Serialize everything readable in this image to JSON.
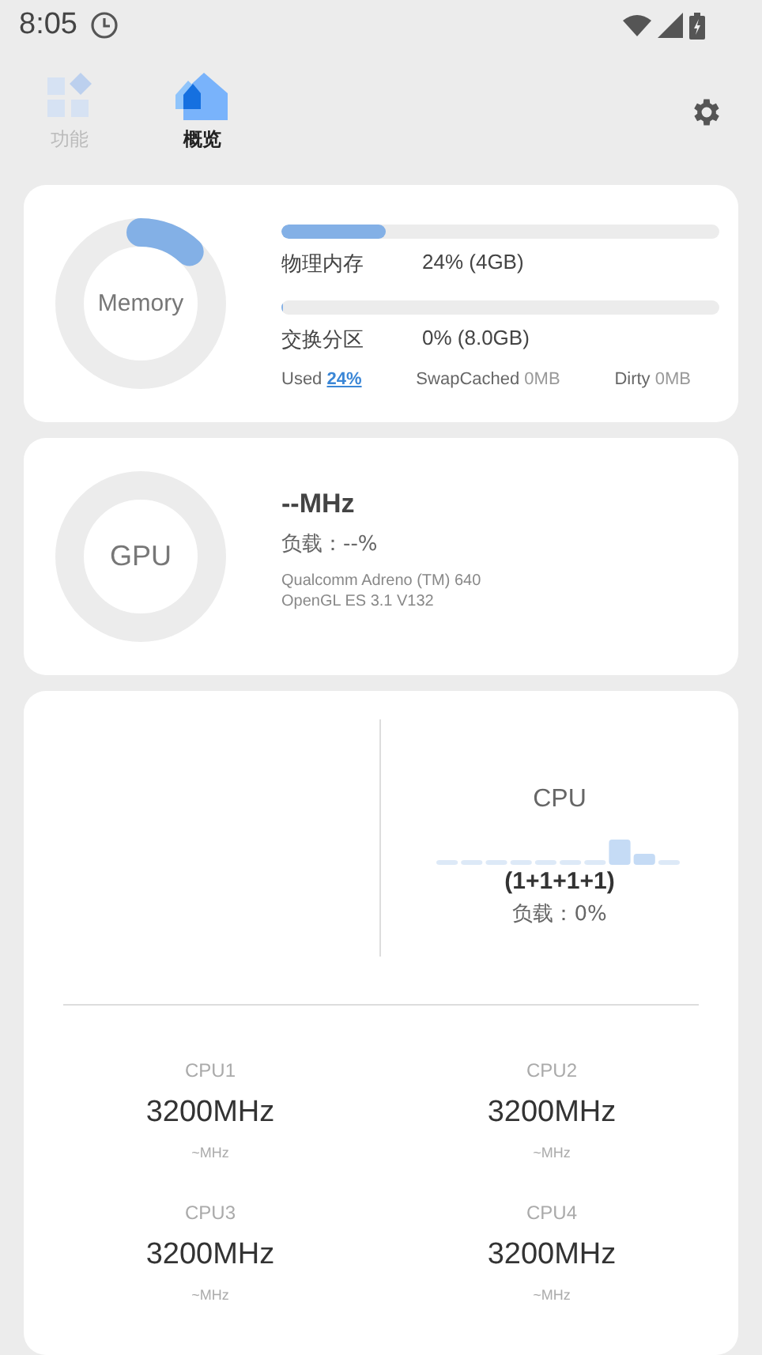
{
  "status_bar": {
    "time": "8:05"
  },
  "tabs": [
    {
      "label": "功能",
      "selected": false
    },
    {
      "label": "概览",
      "selected": true
    }
  ],
  "memory": {
    "title": "Memory",
    "level": 0.12,
    "bars": [
      {
        "label": "物理内存",
        "value": "24% (4GB)",
        "level": 0.24
      },
      {
        "label": "交换分区",
        "value": "0% (8.0GB)",
        "level": 0
      }
    ],
    "used_label": "Used",
    "used_value": "24%",
    "swap_cached_label": "SwapCached",
    "swap_cached_value": "0MB",
    "dirty_label": "Dirty",
    "dirty_value": "0MB"
  },
  "gpu": {
    "title": "GPU",
    "freq": "--MHz",
    "load": "负载：--%",
    "renderer": "Qualcomm Adreno (TM) 640",
    "version": "OpenGL ES 3.1 V132"
  },
  "cpu": {
    "title": "CPU",
    "cluster": "(1+1+1+1)",
    "load": "负载：0%",
    "cores": [
      {
        "name": "CPU1",
        "freq": "3200MHz",
        "sub": "~MHz"
      },
      {
        "name": "CPU2",
        "freq": "3200MHz",
        "sub": "~MHz"
      },
      {
        "name": "CPU3",
        "freq": "3200MHz",
        "sub": "~MHz"
      },
      {
        "name": "CPU4",
        "freq": "3200MHz",
        "sub": "~MHz"
      }
    ]
  }
}
